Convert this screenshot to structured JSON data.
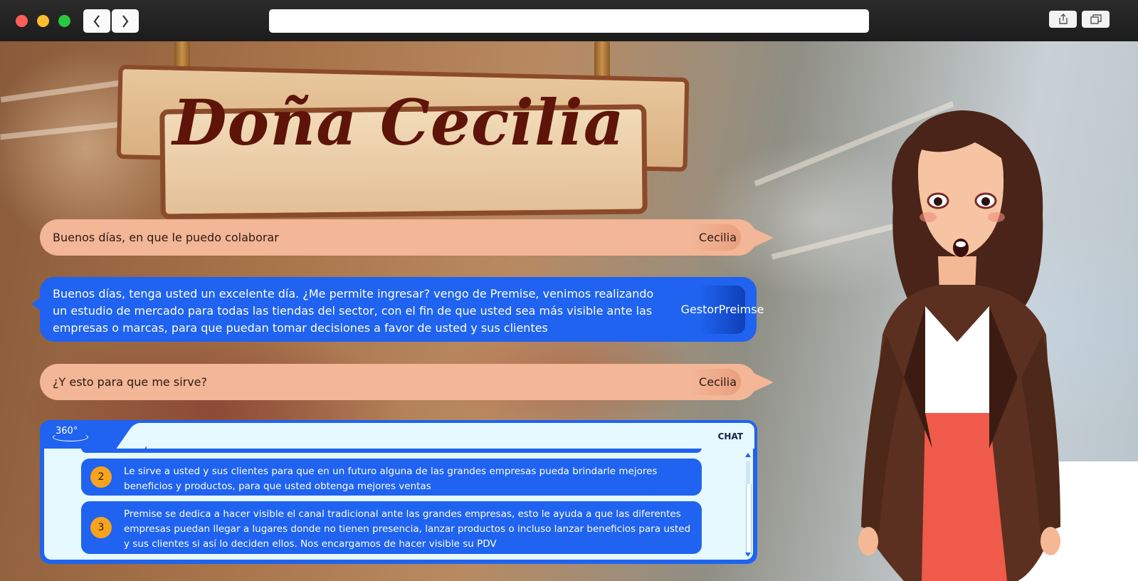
{
  "sign": {
    "title": "Doña Cecilia"
  },
  "conversation": [
    {
      "speaker": "Cecilia",
      "text": "Buenos días, en que le puedo colaborar"
    },
    {
      "speaker": "Gestor Preimse",
      "text": "Buenos días, tenga usted un excelente día. ¿Me permite ingresar? vengo de Premise, venimos realizando un estudio de mercado para todas las tiendas del sector, con el fin de que usted sea más visible ante las empresas o marcas, para que puedan tomar decisiones a favor de usted y sus clientes"
    },
    {
      "speaker": "Cecilia",
      "text": "¿Y esto para que me sirve?"
    }
  ],
  "gestor_label": {
    "line1": "Gestor",
    "line2": "Preimse"
  },
  "chat": {
    "title": "CHAT",
    "badge": "360°",
    "options": [
      {
        "number": "2",
        "text": "Le sirve a usted y sus clientes para que en un futuro alguna de las grandes empresas pueda brindarle mejores beneficios y productos, para que usted obtenga mejores ventas"
      },
      {
        "number": "3",
        "text": "Premise se dedica a hacer visible el canal tradicional ante las grandes empresas, esto le ayuda a que las diferentes empresas puedan llegar a lugares donde no tienen presencia, lanzar productos o incluso lanzar beneficios para usted y sus clientes si así lo deciden ellos. Nos encargamos de hacer visible su PDV"
      }
    ]
  },
  "colors": {
    "peach": "#f3b696",
    "blue": "#1f63f0",
    "orange": "#f7a31e",
    "panel": "#e6f9ff"
  }
}
